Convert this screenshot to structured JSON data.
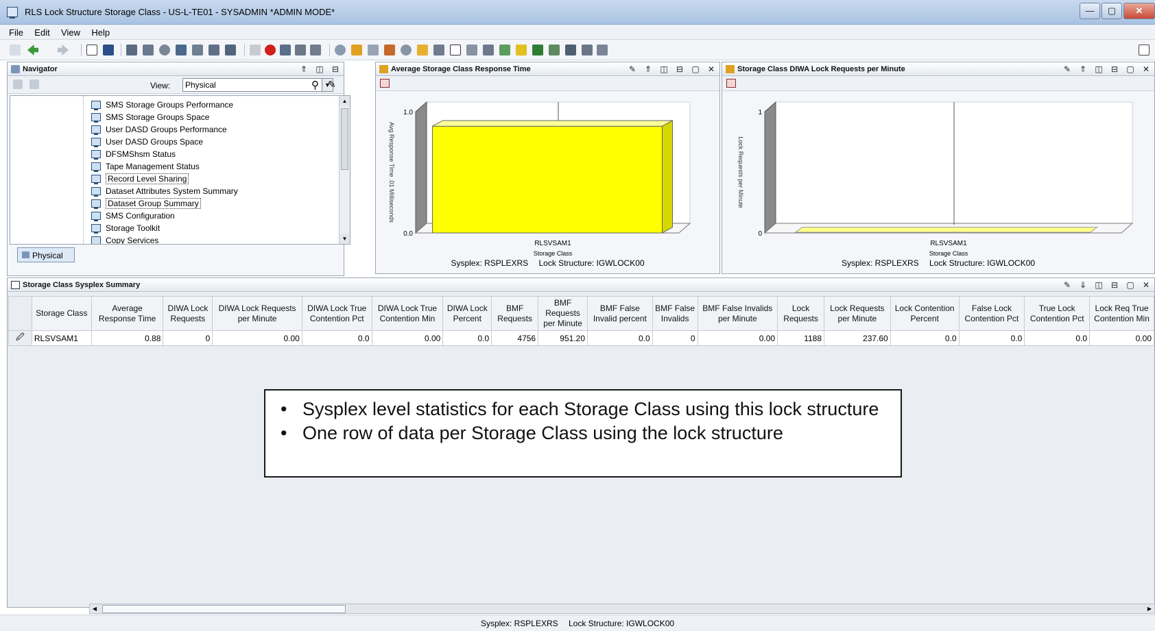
{
  "window": {
    "title": "RLS Lock Structure Storage Class - US-L-TE01 - SYSADMIN   *ADMIN MODE*",
    "buttons": {
      "minimize": "—",
      "maximize": "▢",
      "close": "✕"
    }
  },
  "menu": [
    "File",
    "Edit",
    "View",
    "Help"
  ],
  "navigator": {
    "title": "Navigator",
    "view_label": "View:",
    "view_value": "Physical",
    "items": [
      {
        "label": "SMS Storage Groups Performance"
      },
      {
        "label": "SMS Storage Groups Space"
      },
      {
        "label": "User DASD Groups Performance"
      },
      {
        "label": "User DASD Groups Space"
      },
      {
        "label": "DFSMShsm Status"
      },
      {
        "label": "Tape Management Status"
      },
      {
        "label": "Record Level Sharing"
      },
      {
        "label": "Dataset Attributes System Summary"
      },
      {
        "label": "Dataset Group Summary"
      },
      {
        "label": "SMS Configuration"
      },
      {
        "label": "Storage Toolkit"
      },
      {
        "label": "Copy Services"
      }
    ],
    "tab": "Physical"
  },
  "chart1": {
    "title": "Average Storage Class Response Time",
    "footer_sysplex": "Sysplex: RSPLEXRS",
    "footer_lock": "Lock Structure: IGWLOCK00"
  },
  "chart2": {
    "title": "Storage Class DIWA Lock Requests per Minute",
    "footer_sysplex": "Sysplex: RSPLEXRS",
    "footer_lock": "Lock Structure: IGWLOCK00"
  },
  "chart_data": [
    {
      "type": "bar",
      "categories": [
        "RLSVSAM1"
      ],
      "values": [
        0.88
      ],
      "xlabel": "Storage Class",
      "ylabel": "Avg Response Time .01 Milliseconds",
      "ylim": [
        0.0,
        1.0
      ],
      "ticks": [
        "0.0",
        "1.0"
      ],
      "color": "#ffff00"
    },
    {
      "type": "bar",
      "categories": [
        "RLSVSAM1"
      ],
      "values": [
        0
      ],
      "xlabel": "Storage Class",
      "ylabel": "Lock Requests per Minute",
      "ylim": [
        0,
        1
      ],
      "ticks": [
        "0",
        "1"
      ],
      "color": "#ffff8a"
    }
  ],
  "summary": {
    "title": "Storage Class Sysplex Summary",
    "columns": [
      "Storage Class",
      "Average Response Time",
      "DIWA Lock Requests",
      "DIWA Lock Requests per Minute",
      "DIWA Lock True Contention Pct",
      "DIWA Lock True Contention Min",
      "DIWA Lock Percent",
      "BMF Requests",
      "BMF Requests per Minute",
      "BMF False Invalid percent",
      "BMF False Invalids",
      "BMF False Invalids per Minute",
      "Lock Requests",
      "Lock Requests per Minute",
      "Lock Contention Percent",
      "False Lock Contention Pct",
      "True Lock Contention Pct",
      "Lock Req True Contention Min"
    ],
    "rows": [
      [
        "RLSVSAM1",
        "0.88",
        "0",
        "0.00",
        "0.0",
        "0.00",
        "0.0",
        "4756",
        "951.20",
        "0.0",
        "0",
        "0.00",
        "1188",
        "237.60",
        "0.0",
        "0.0",
        "0.0",
        "0.00"
      ]
    ]
  },
  "callout": {
    "bullets": [
      "Sysplex level statistics for each Storage Class using this lock structure",
      "One row of data per Storage Class using the lock structure"
    ]
  },
  "status": {
    "sysplex": "Sysplex: RSPLEXRS",
    "lock": "Lock Structure: IGWLOCK00"
  }
}
